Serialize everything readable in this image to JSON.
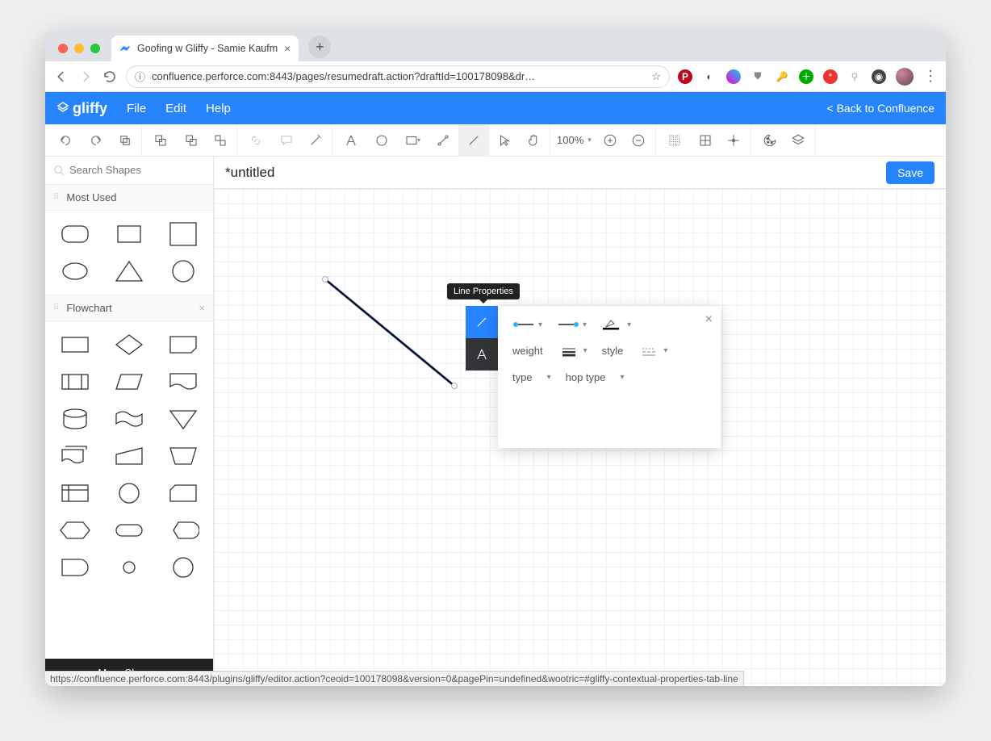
{
  "browser": {
    "tab_title": "Goofing w Gliffy - Samie Kaufm",
    "url_display": "confluence.perforce.com:8443/pages/resumedraft.action?draftId=100178098&dr…",
    "newtab_plus": "+"
  },
  "app": {
    "logo_text": "gliffy",
    "menu": {
      "file": "File",
      "edit": "Edit",
      "help": "Help"
    },
    "back_link": "< Back to Confluence"
  },
  "toolbar": {
    "zoom_label": "100%"
  },
  "sidebar": {
    "search_placeholder": "Search Shapes",
    "sections": {
      "most_used": "Most Used",
      "flowchart": "Flowchart"
    },
    "more_shapes": "More Shapes"
  },
  "doc": {
    "title": "*untitled",
    "save": "Save"
  },
  "props": {
    "tooltip": "Line Properties",
    "weight_label": "weight",
    "style_label": "style",
    "type_label": "type",
    "hoptype_label": "hop type"
  },
  "status_url": "https://confluence.perforce.com:8443/plugins/gliffy/editor.action?ceoid=100178098&version=0&pagePin=undefined&wootric=#gliffy-contextual-properties-tab-line"
}
